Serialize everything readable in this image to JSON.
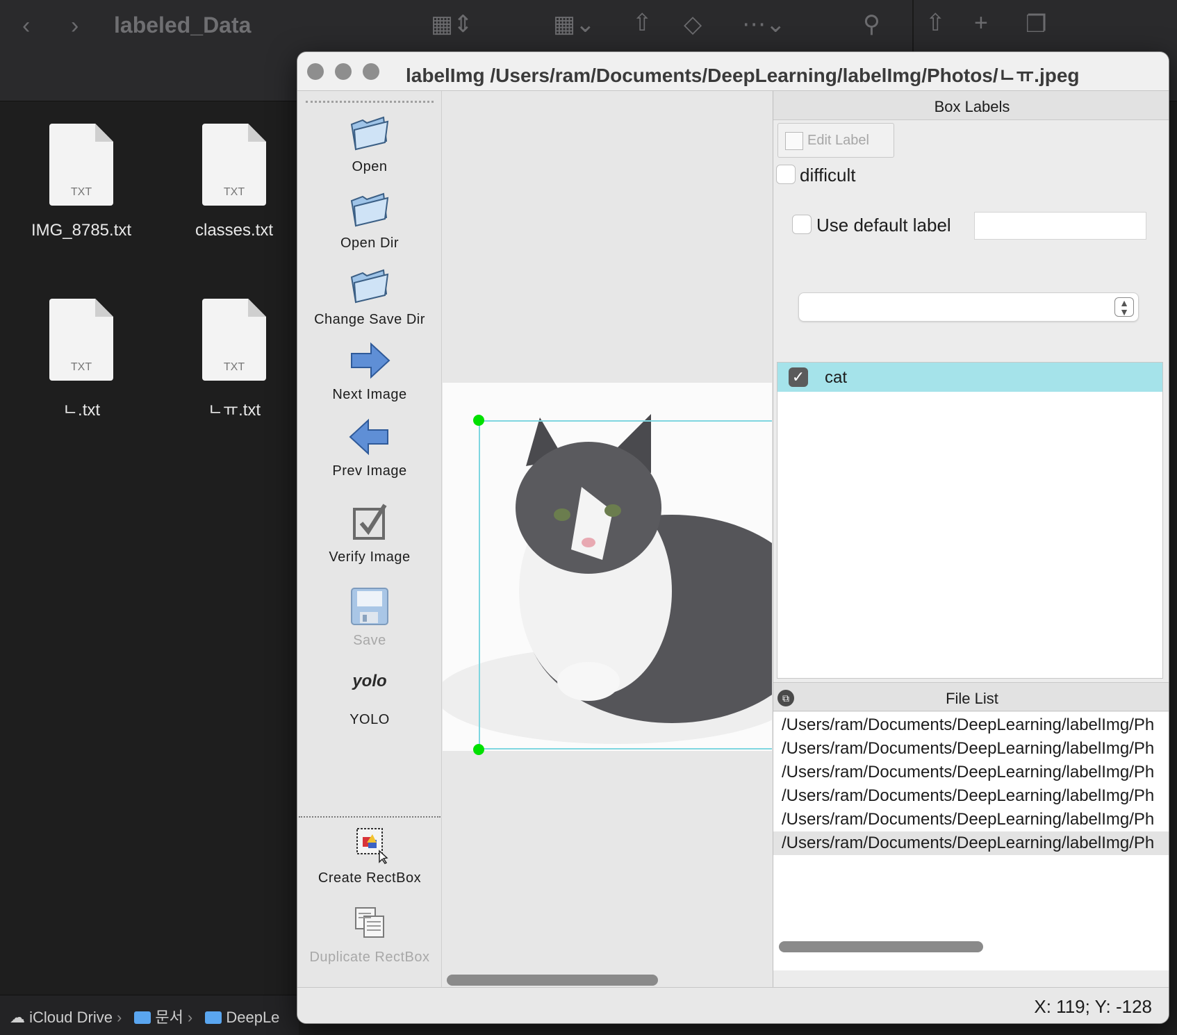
{
  "finder": {
    "title": "labeled_Data",
    "files": [
      {
        "name": "IMG_8785.txt",
        "ext": "TXT"
      },
      {
        "name": "classes.txt",
        "ext": "TXT"
      },
      {
        "name": "ㄴ.txt",
        "ext": "TXT"
      },
      {
        "name": "ㄴㅠ.txt",
        "ext": "TXT"
      }
    ],
    "path": [
      "iCloud Drive",
      "문서",
      "DeepLe"
    ]
  },
  "window": {
    "title": "labelImg /Users/ram/Documents/DeepLearning/labelImg/Photos/ㄴㅠ.jpeg"
  },
  "tools": {
    "open": "Open",
    "open_dir": "Open Dir",
    "change_save_dir": "Change Save Dir",
    "next_image": "Next Image",
    "prev_image": "Prev Image",
    "verify_image": "Verify Image",
    "save": "Save",
    "yolo_icon_text": "yolo",
    "yolo": "YOLO",
    "create_rectbox": "Create RectBox",
    "duplicate_rectbox": "Duplicate RectBox"
  },
  "box_labels": {
    "header": "Box Labels",
    "edit_label": "Edit Label",
    "difficult": "difficult",
    "use_default_label": "Use default label",
    "default_label_value": "",
    "labels": [
      {
        "text": "cat",
        "checked": true
      }
    ]
  },
  "file_list": {
    "header": "File List",
    "files": [
      "/Users/ram/Documents/DeepLearning/labelImg/Ph",
      "/Users/ram/Documents/DeepLearning/labelImg/Ph",
      "/Users/ram/Documents/DeepLearning/labelImg/Ph",
      "/Users/ram/Documents/DeepLearning/labelImg/Ph",
      "/Users/ram/Documents/DeepLearning/labelImg/Ph",
      "/Users/ram/Documents/DeepLearning/labelImg/Ph"
    ],
    "selected_index": 5
  },
  "status": {
    "text": "X: 119; Y: -128"
  },
  "colors": {
    "selection": "#a5e3ea",
    "bbox": "#7fd6e0",
    "vertex": "#00e000"
  }
}
